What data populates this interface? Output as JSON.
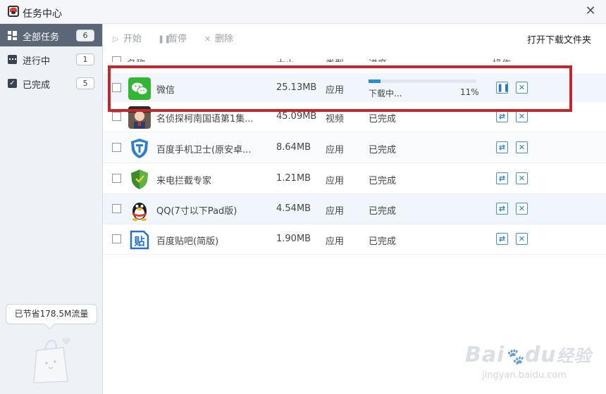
{
  "window": {
    "title": "任务中心",
    "close_icon": "close-icon"
  },
  "sidebar": {
    "items": [
      {
        "label": "全部任务",
        "count": "6",
        "icon": "grid-icon",
        "active": true
      },
      {
        "label": "进行中",
        "count": "1",
        "icon": "dots-icon",
        "active": false
      },
      {
        "label": "已完成",
        "count": "5",
        "icon": "checkbox-icon",
        "active": false
      }
    ],
    "savings_text": "已节省178.5M流量"
  },
  "toolbar": {
    "start_label": "开始",
    "pause_label": "暂停",
    "delete_label": "删除",
    "open_folder_label": "打开下载文件夹"
  },
  "table": {
    "columns": [
      "名称",
      "大小",
      "类型",
      "进度",
      "操作"
    ],
    "rows": [
      {
        "name": "微信",
        "size": "25.13MB",
        "type": "应用",
        "status": "下载中...",
        "progress": 0.11,
        "percent": "11%",
        "icon": "wechat-icon",
        "action": "pause"
      },
      {
        "name": "名侦探柯南国语第1集...",
        "size": "45.09MB",
        "type": "视频",
        "status": "已完成",
        "icon": "conan-thumbnail",
        "action": "reinstall"
      },
      {
        "name": "百度手机卫士(原安卓...",
        "size": "8.64MB",
        "type": "应用",
        "status": "已完成",
        "icon": "shield-t-icon",
        "action": "reinstall"
      },
      {
        "name": "来电拦截专家",
        "size": "1.21MB",
        "type": "应用",
        "status": "已完成",
        "icon": "green-shield-icon",
        "action": "reinstall"
      },
      {
        "name": "QQ(7寸以下Pad版)",
        "size": "4.54MB",
        "type": "应用",
        "status": "已完成",
        "icon": "qq-penguin-icon",
        "action": "reinstall"
      },
      {
        "name": "百度贴吧(简版)",
        "size": "1.90MB",
        "type": "应用",
        "status": "已完成",
        "icon": "tieba-icon",
        "action": "reinstall"
      }
    ]
  },
  "watermark": {
    "brand": "Bai",
    "brand_tail": "du",
    "cn": "经验",
    "url": "jingyan.baidu.com"
  },
  "colors": {
    "accent": "#2d8cd0",
    "highlight_border": "#c8242b",
    "sidebar_active": "#5b6777"
  }
}
